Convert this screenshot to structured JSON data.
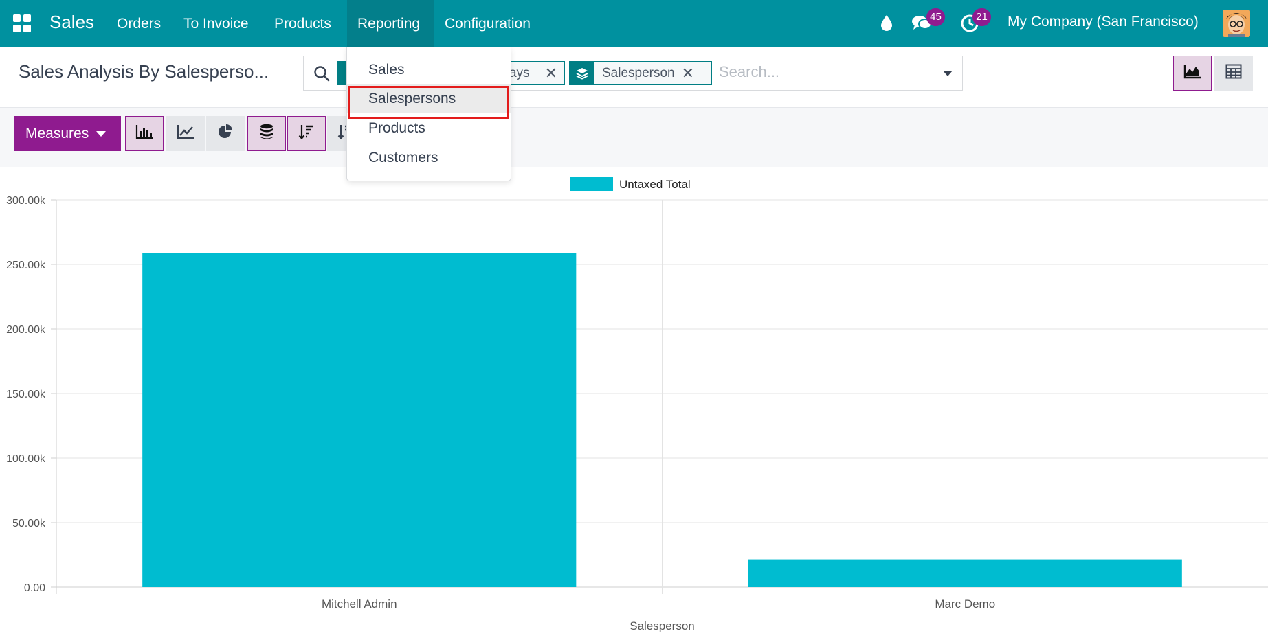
{
  "navbar": {
    "brand": "Sales",
    "menu": [
      "Orders",
      "To Invoice",
      "Products",
      "Reporting",
      "Configuration"
    ],
    "active_menu": "Reporting",
    "messages_count": "45",
    "activities_count": "21",
    "company": "My Company (San Francisco)"
  },
  "control_panel": {
    "title": "Sales Analysis By Salesperso...",
    "facets": [
      {
        "label": "ays",
        "icon": "filter-icon"
      },
      {
        "label": "Salesperson",
        "icon": "group-by-layers-icon"
      }
    ],
    "search_placeholder": "Search...",
    "views": [
      {
        "name": "graph-view",
        "icon": "area-chart-icon",
        "active": true
      },
      {
        "name": "pivot-view",
        "icon": "table-grid-icon",
        "active": false
      }
    ]
  },
  "toolbar": {
    "measures_label": "Measures",
    "buttons": [
      {
        "name": "bar-chart",
        "icon": "bar-chart-icon",
        "active": true
      },
      {
        "name": "line-chart",
        "icon": "line-chart-icon",
        "active": false
      },
      {
        "name": "pie-chart",
        "icon": "pie-chart-icon",
        "active": false
      },
      {
        "name": "stacked",
        "icon": "database-stack-icon",
        "active": true
      },
      {
        "name": "sort-descending",
        "icon": "sort-descending-icon",
        "active": true
      },
      {
        "name": "sort-ascending",
        "icon": "sort-ascending-icon",
        "active": false
      }
    ]
  },
  "reporting_menu": {
    "items": [
      "Sales",
      "Salespersons",
      "Products",
      "Customers"
    ],
    "highlighted": "Salespersons"
  },
  "colors": {
    "navbar": "#00919f",
    "accent": "#8f1b8f",
    "bar": "#00bcd0"
  },
  "chart_data": {
    "type": "bar",
    "categories": [
      "Mitchell Admin",
      "Marc Demo"
    ],
    "series": [
      {
        "name": "Untaxed Total",
        "values": [
          259000,
          21500
        ]
      }
    ],
    "xlabel": "Salesperson",
    "ylabel": "",
    "ylim": [
      0,
      300000
    ],
    "yticks": [
      "0.00",
      "50.00k",
      "100.00k",
      "150.00k",
      "200.00k",
      "250.00k",
      "300.00k"
    ],
    "grid": true,
    "legend": "top-center"
  }
}
